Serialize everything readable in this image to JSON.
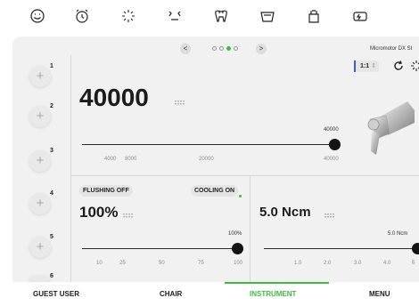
{
  "device": {
    "model": "Micromotor DX SI"
  },
  "top_icons": [
    "face-icon",
    "alarm-clock-icon",
    "light-icon",
    "handpiece-icon",
    "tooth-icon",
    "cup-icon",
    "spittoon-icon",
    "rinse-icon"
  ],
  "pager": {
    "prev": "<",
    "next": ">",
    "pages": 4,
    "active": 2
  },
  "presets": [
    "1",
    "2",
    "3",
    "4",
    "5",
    "6"
  ],
  "speed": {
    "value": "40000",
    "slider_value": "40000",
    "scale_max": "40000",
    "ticks": [
      "4000",
      "8000",
      "20000",
      "40000"
    ],
    "level": 1.0
  },
  "ratio": {
    "label": "1:1"
  },
  "flushing": {
    "label": "FLUSHING OFF",
    "value": "100%",
    "slider_value": "100%",
    "level": 1.0,
    "ticks": [
      "10",
      "25",
      "50",
      "75",
      "100"
    ]
  },
  "cooling": {
    "label": "COOLING ON"
  },
  "torque": {
    "value": "5.0 Ncm",
    "slider_value": "5.0 Ncm",
    "level": 1.0,
    "ticks": [
      "1.0",
      "2.0",
      "3.0",
      "4.0",
      "5"
    ]
  },
  "colors": {
    "accent": "#3bbf3b",
    "panel": "#f1f1f1",
    "knob": "#141414"
  },
  "bottom_nav": {
    "guest": "GUEST USER",
    "chair": "CHAIR",
    "instrument": "INSTRUMENT",
    "menu": "MENU",
    "active": "INSTRUMENT"
  }
}
